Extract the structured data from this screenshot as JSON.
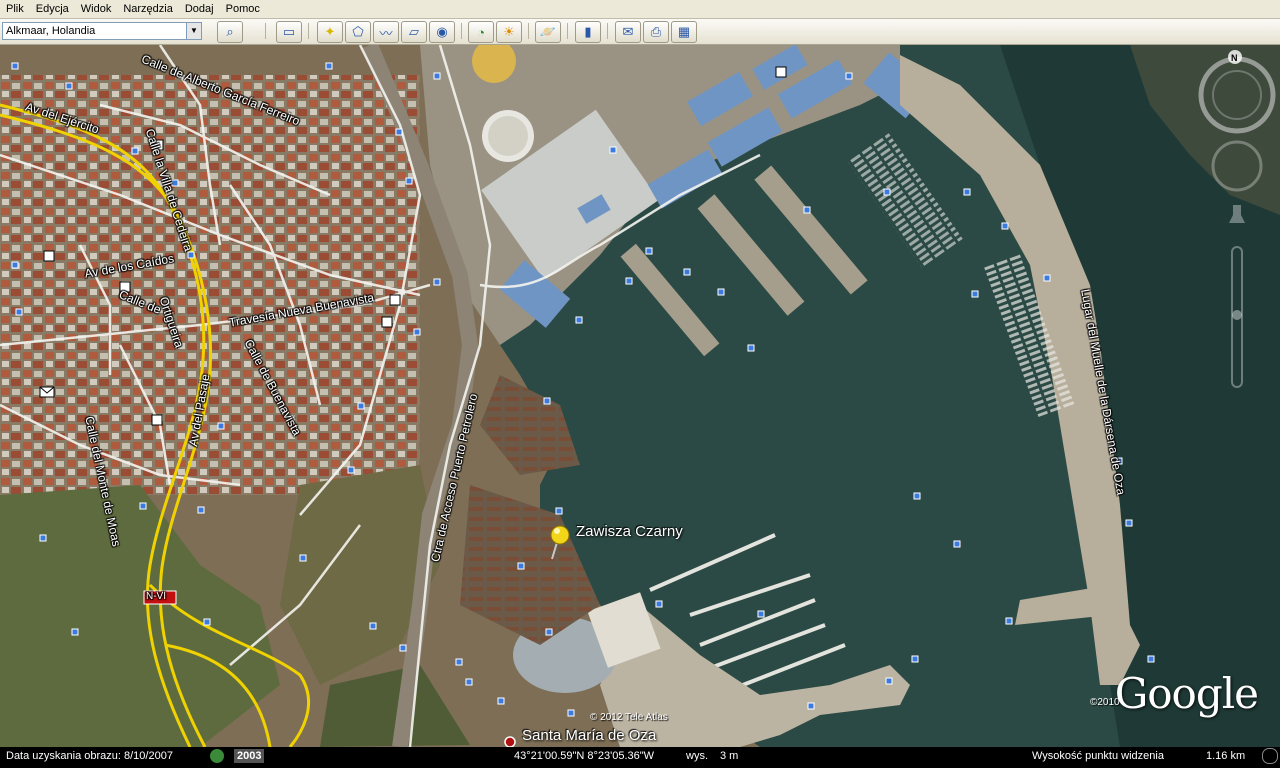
{
  "menu": [
    "Plik",
    "Edycja",
    "Widok",
    "Narzędzia",
    "Dodaj",
    "Pomoc"
  ],
  "search": {
    "value": "Alkmaar, Holandia"
  },
  "map": {
    "placemark_label": "Zawisza Czarny",
    "place_name": "Santa María de Oza",
    "streets": [
      "Calle de Alberto García Ferreiro",
      "Calle la Villa de Cedeira",
      "Av del Ejército",
      "Av de los Caídos",
      "Calle de",
      "Ortigueira",
      "Travesía Nueva Buenavista",
      "Calle de Buenavista",
      "Av del Pasaje",
      "Calle del Monte de Moas",
      "Ctra de Acceso Puerto Petrolero",
      "Lugar del Muelle de la Dársena de Oza"
    ],
    "road_shield": "N-VI",
    "copyright_imagery": "© 2012 Tele Atlas",
    "copyright_year": "©2010",
    "logo": "Google"
  },
  "status": {
    "imagery_date_label": "Data uzyskania obrazu: 8/10/2007",
    "year_badge": "2003",
    "coordinates": "43°21'00.59\"N    8°23'05.36\"W",
    "elevation_label": "wys.",
    "elevation_value": "3 m",
    "eye_alt_label": "Wysokość punktu widzenia",
    "eye_alt_value": "1.16 km"
  },
  "colors": {
    "water": "#2c4a45",
    "land": "#7d6e55",
    "road_yellow": "#f0d200",
    "pin": "#f3d51a",
    "status_bg": "#000000"
  }
}
